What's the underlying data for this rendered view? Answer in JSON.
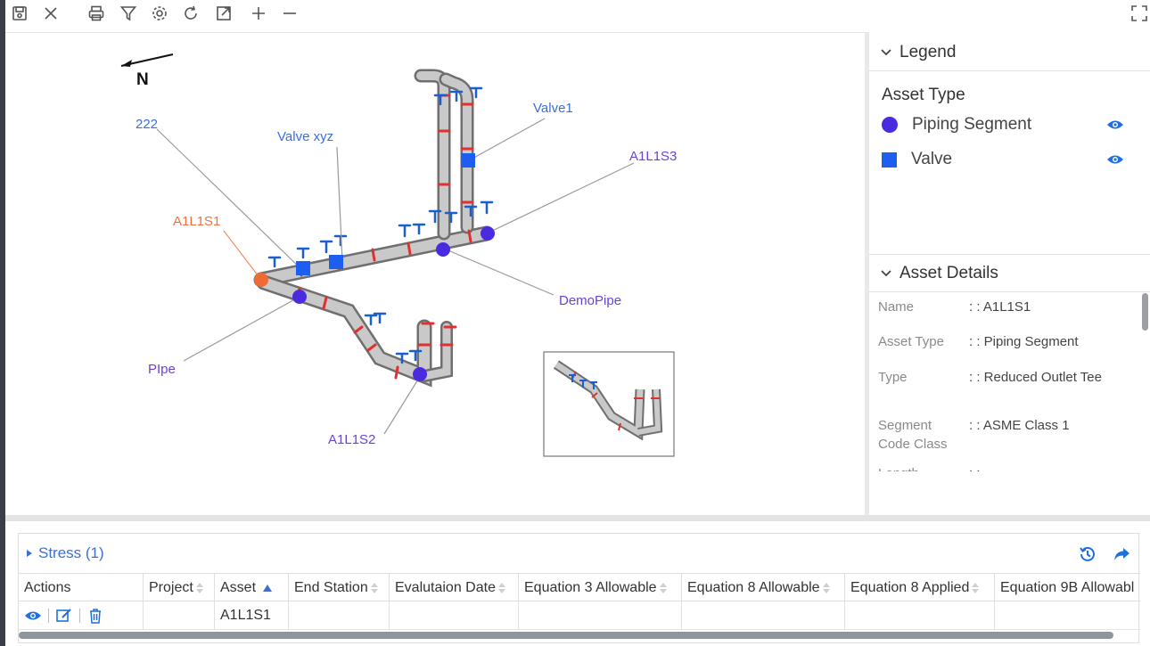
{
  "toolbar": {
    "icons": [
      "save-icon",
      "close-icon",
      "print-icon",
      "filter-icon",
      "settings-icon",
      "refresh-icon",
      "export-icon",
      "zoom-in-icon",
      "zoom-out-icon",
      "fullscreen-icon"
    ]
  },
  "canvas": {
    "north_label": "N",
    "labels": {
      "l222": "222",
      "valve_xyz": "Valve xyz",
      "valve1": "Valve1",
      "a1l1s3": "A1L1S3",
      "a1l1s1": "A1L1S1",
      "demopipe": "DemoPipe",
      "pipe": "PIpe",
      "a1l1s2": "A1L1S2"
    },
    "colors": {
      "segment": "#4b2be0",
      "valve": "#1d5ef0",
      "selected": "#f06a35",
      "pipe": "#b8b8b8",
      "flange": "#e03030",
      "handle": "#1a5fd0"
    }
  },
  "legend": {
    "title": "Legend",
    "subtitle": "Asset Type",
    "items": [
      {
        "label": "Piping Segment",
        "symbol": "circle",
        "color": "#4b2be0"
      },
      {
        "label": "Valve",
        "symbol": "square",
        "color": "#1d5ef0"
      }
    ]
  },
  "details": {
    "title": "Asset Details",
    "rows": [
      {
        "key": "Name",
        "value": ": : A1L1S1"
      },
      {
        "key": "Asset Type",
        "value": ": : Piping Segment"
      },
      {
        "key": "Type",
        "value": ": : Reduced Outlet Tee"
      },
      {
        "key": "Segment Code Class",
        "value": ": : ASME Class 1"
      },
      {
        "key": "Length",
        "value": ": :"
      }
    ]
  },
  "grid": {
    "title": "Stress (1)",
    "columns": [
      "Actions",
      "Project",
      "Asset",
      "End Station",
      "Evalutaion Date",
      "Equation 3 Allowable",
      "Equation 8 Allowable",
      "Equation 8 Applied",
      "Equation 9B Allowabl"
    ],
    "rows": [
      {
        "asset": "A1L1S1"
      }
    ]
  }
}
